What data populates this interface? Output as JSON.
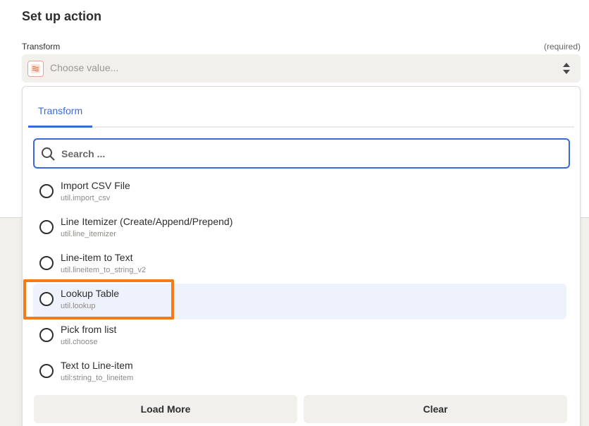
{
  "header": {
    "title": "Set up action"
  },
  "field": {
    "label": "Transform",
    "required": "(required)",
    "placeholder": "Choose value...",
    "icon": "transform-app-icon"
  },
  "dropdown": {
    "tabs": [
      {
        "label": "Transform"
      }
    ],
    "search_placeholder": "Search ...",
    "items": [
      {
        "title": "Import CSV File",
        "key": "util.import_csv"
      },
      {
        "title": "Line Itemizer (Create/Append/Prepend)",
        "key": "util.line_itemizer"
      },
      {
        "title": "Line-item to Text",
        "key": "util.lineitem_to_string_v2"
      },
      {
        "title": "Lookup Table",
        "key": "util.lookup"
      },
      {
        "title": "Pick from list",
        "key": "util.choose"
      },
      {
        "title": "Text to Line-item",
        "key": "util:string_to_lineitem"
      }
    ],
    "load_more": "Load More",
    "clear": "Clear"
  },
  "colors": {
    "accent": "#3b69d9",
    "highlight": "#f47b16",
    "hover_bg": "#edf2fd"
  }
}
